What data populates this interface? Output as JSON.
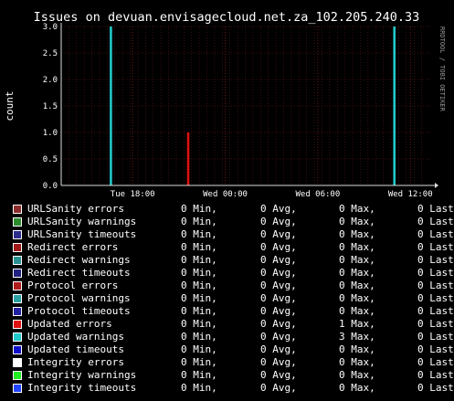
{
  "chart_data": {
    "type": "bar",
    "title": "Issues on devuan.envisagecloud.net.za_102.205.240.33",
    "ylabel": "count",
    "watermark": "RRDTOOL / TOBI OETIKER",
    "ylim": [
      0,
      3
    ],
    "yticks": [
      "0.0",
      "0.5",
      "1.0",
      "1.5",
      "2.0",
      "2.5",
      "3.0"
    ],
    "xticks": [
      "Tue 18:00",
      "Wed 00:00",
      "Wed 06:00",
      "Wed 12:00"
    ],
    "grid": true,
    "series": [
      {
        "name": "URLSanity errors",
        "color": "#8b2c2c",
        "stats": [
          "0 Min,",
          "0 Avg,",
          "0 Max,",
          "0 Last"
        ],
        "spikes": []
      },
      {
        "name": "URLSanity warnings",
        "color": "#2c8b2c",
        "stats": [
          "0 Min,",
          "0 Avg,",
          "0 Max,",
          "0 Last"
        ],
        "spikes": []
      },
      {
        "name": "URLSanity timeouts",
        "color": "#2c2c8b",
        "stats": [
          "0 Min,",
          "0 Avg,",
          "0 Max,",
          "0 Last"
        ],
        "spikes": []
      },
      {
        "name": "Redirect errors",
        "color": "#a01818",
        "stats": [
          "0 Min,",
          "0 Avg,",
          "0 Max,",
          "0 Last"
        ],
        "spikes": []
      },
      {
        "name": "Redirect warnings",
        "color": "#2a9090",
        "stats": [
          "0 Min,",
          "0 Avg,",
          "0 Max,",
          "0 Last"
        ],
        "spikes": []
      },
      {
        "name": "Redirect timeouts",
        "color": "#202080",
        "stats": [
          "0 Min,",
          "0 Avg,",
          "0 Max,",
          "0 Last"
        ],
        "spikes": []
      },
      {
        "name": "Protocol errors",
        "color": "#b01c1c",
        "stats": [
          "0 Min,",
          "0 Avg,",
          "0 Max,",
          "0 Last"
        ],
        "spikes": []
      },
      {
        "name": "Protocol warnings",
        "color": "#2aa0a0",
        "stats": [
          "0 Min,",
          "0 Avg,",
          "0 Max,",
          "0 Last"
        ],
        "spikes": []
      },
      {
        "name": "Protocol timeouts",
        "color": "#2222a0",
        "stats": [
          "0 Min,",
          "0 Avg,",
          "0 Max,",
          "0 Last"
        ],
        "spikes": []
      },
      {
        "name": "Updated errors",
        "color": "#dd1111",
        "stats": [
          "0 Min,",
          "0 Avg,",
          "1 Max,",
          "0 Last"
        ],
        "spikes": [
          {
            "t": 0.345,
            "v": 1
          }
        ]
      },
      {
        "name": "Updated warnings",
        "color": "#22c8c8",
        "stats": [
          "0 Min,",
          "0 Avg,",
          "3 Max,",
          "0 Last"
        ],
        "spikes": [
          {
            "t": 0.135,
            "v": 3
          },
          {
            "t": 0.905,
            "v": 3
          }
        ]
      },
      {
        "name": "Updated timeouts",
        "color": "#1111cc",
        "stats": [
          "0 Min,",
          "0 Avg,",
          "0 Max,",
          "0 Last"
        ],
        "spikes": []
      },
      {
        "name": "Integrity errors",
        "color": "#ffffff",
        "stats": [
          "0 Min,",
          "0 Avg,",
          "0 Max,",
          "0 Last"
        ],
        "spikes": []
      },
      {
        "name": "Integrity warnings",
        "color": "#22ee22",
        "stats": [
          "0 Min,",
          "0 Avg,",
          "0 Max,",
          "0 Last"
        ],
        "spikes": []
      },
      {
        "name": "Integrity timeouts",
        "color": "#2244ff",
        "stats": [
          "0 Min,",
          "0 Avg,",
          "0 Max,",
          "0 Last"
        ],
        "spikes": []
      }
    ]
  }
}
